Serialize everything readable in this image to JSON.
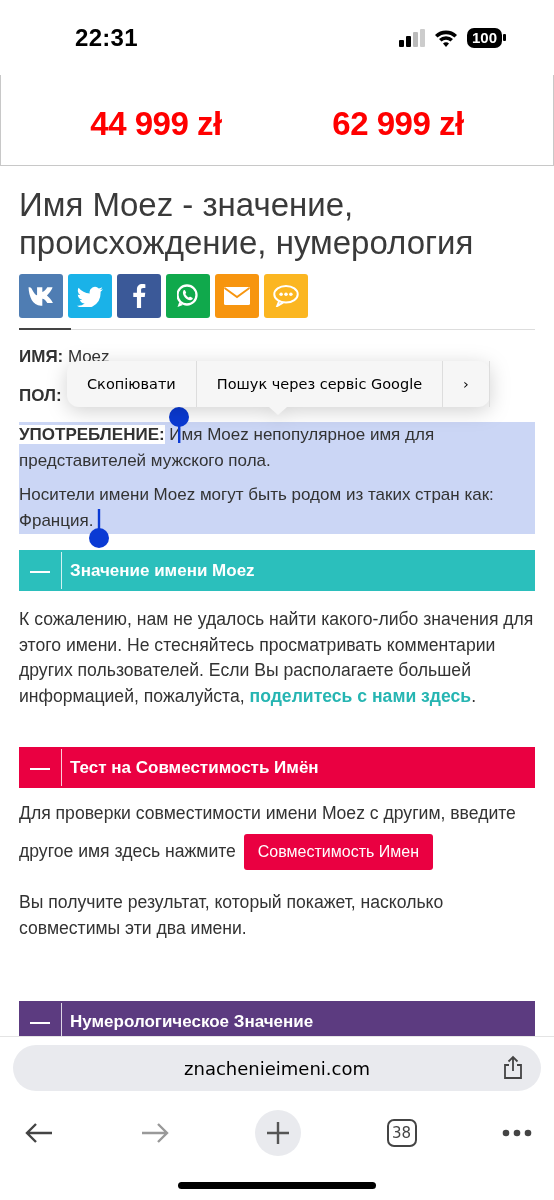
{
  "status_bar": {
    "time": "22:31",
    "battery": "100"
  },
  "ad": {
    "prices": [
      "44 999 zł",
      "62 999 zł"
    ]
  },
  "article": {
    "title": "Имя Moez - значение, происхождение, нумерология",
    "share_buttons": [
      {
        "kind": "vk",
        "color": "#4f7db3"
      },
      {
        "kind": "twitter",
        "color": "#1ab2e8"
      },
      {
        "kind": "facebook",
        "color": "#3b5998"
      },
      {
        "kind": "whatsapp",
        "color": "#10a94c"
      },
      {
        "kind": "email",
        "color": "#f7950f"
      },
      {
        "kind": "sms",
        "color": "#fbb621"
      }
    ],
    "fields": [
      {
        "label": "ИМЯ:",
        "value": "Moez",
        "selected": false
      },
      {
        "label": "ПОЛ:",
        "selected": false
      },
      {
        "label": "УПОТРЕБЛЕНИЕ:",
        "value": "Имя Moez непопулярное имя для представителей мужского пола.",
        "selected": true
      }
    ],
    "origin": {
      "text": "Носители имени Moez могут быть родом из таких стран как: Франция.",
      "selected": true
    }
  },
  "context_menu": {
    "items": [
      "Скопіювати",
      "Пошук через сервіс Google"
    ],
    "more": "›"
  },
  "sections": [
    {
      "toggle": "—",
      "title": "Значение имени Moez",
      "color": "#2bbfbc",
      "body": [
        {
          "kind": "link_text",
          "text": "К сожалению, нам не удалось найти какого-либо значения для этого имени. Не стесняйтесь просматривать комментарии других пользователей. Если Вы располагаете большей информацией, пожалуйста, ",
          "link": "поделитесь с нами здесь",
          "after": "."
        }
      ]
    },
    {
      "toggle": "—",
      "title": "Тест на Совместимость Имён",
      "color": "#ea0041",
      "body": [
        {
          "kind": "button_text",
          "text": "Для проверки совместимости имени Moez с другим, введите другое имя здесь нажмите",
          "button": "Совместимость Имен"
        },
        {
          "kind": "paragraph",
          "text": "Вы получите результат, который покажет, насколько совместимы эти два имени."
        }
      ]
    },
    {
      "toggle": "—",
      "title": "Нумерологическое Значение",
      "color": "#5c3b80"
    }
  ],
  "browser": {
    "url": "znachenieimeni.com",
    "tab_count": "38",
    "forward_disabled": true
  }
}
